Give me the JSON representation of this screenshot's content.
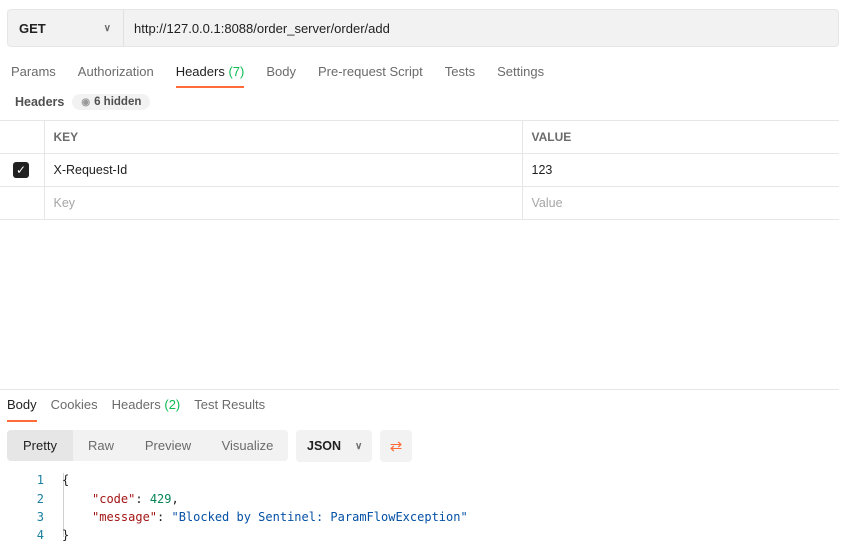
{
  "request": {
    "method": "GET",
    "url": "http://127.0.0.1:8088/order_server/order/add"
  },
  "tabs": [
    {
      "label": "Params"
    },
    {
      "label": "Authorization"
    },
    {
      "label": "Headers",
      "count": "(7)"
    },
    {
      "label": "Body"
    },
    {
      "label": "Pre-request Script"
    },
    {
      "label": "Tests"
    },
    {
      "label": "Settings"
    }
  ],
  "headers_section": {
    "label": "Headers",
    "hidden": "6 hidden"
  },
  "table": {
    "columns": [
      "KEY",
      "VALUE"
    ],
    "rows": [
      {
        "checked": true,
        "key": "X-Request-Id",
        "value": "123"
      }
    ],
    "placeholder": {
      "key": "Key",
      "value": "Value"
    }
  },
  "response": {
    "tabs": [
      {
        "label": "Body"
      },
      {
        "label": "Cookies"
      },
      {
        "label": "Headers",
        "count": "(2)"
      },
      {
        "label": "Test Results"
      }
    ],
    "views": [
      "Pretty",
      "Raw",
      "Preview",
      "Visualize"
    ],
    "format": "JSON",
    "lines": [
      "1",
      "2",
      "3",
      "4"
    ],
    "code": {
      "open": "{",
      "code_key": "\"code\"",
      "code_val": "429",
      "msg_key": "\"message\"",
      "msg_val": "\"Blocked by Sentinel: ParamFlowException\"",
      "close": "}"
    }
  },
  "colors": {
    "accent": "#ff6c37",
    "count": "#0cbb52"
  }
}
